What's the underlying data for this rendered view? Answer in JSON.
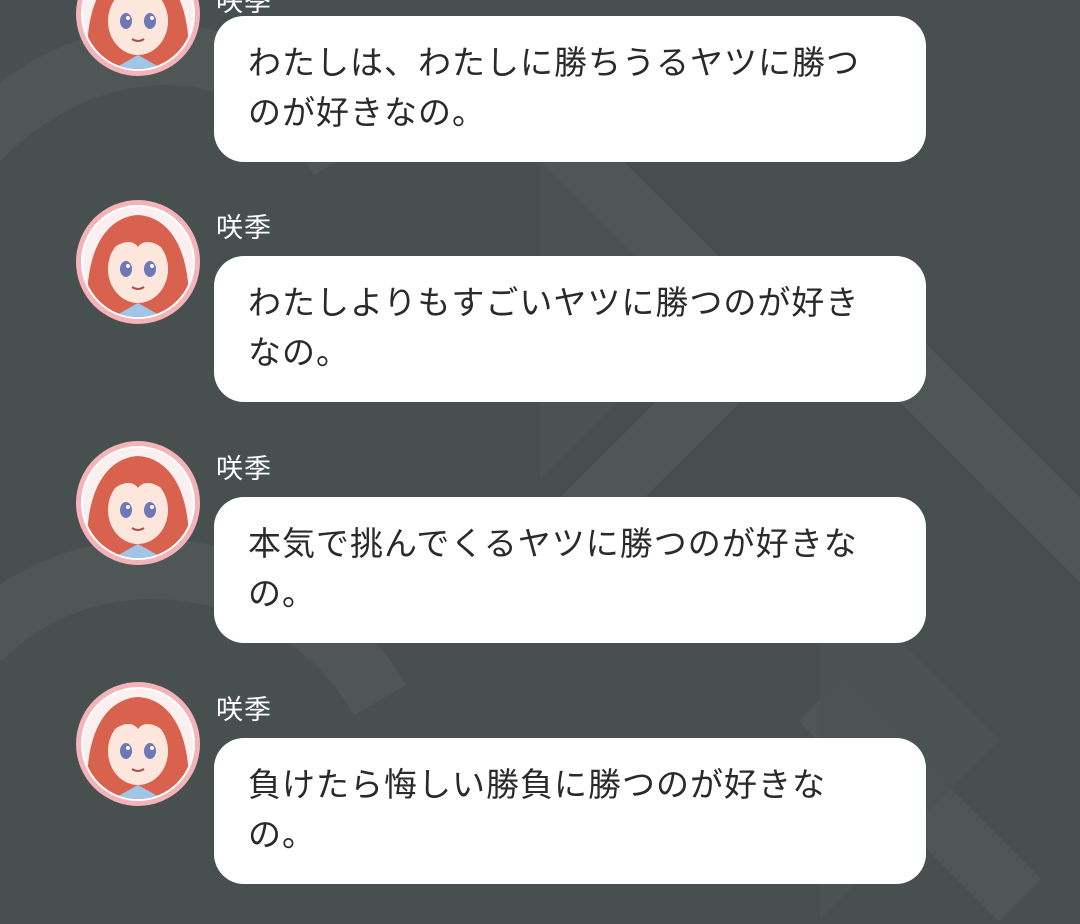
{
  "chat": {
    "messages": [
      {
        "sender": "咲季",
        "text": "わたしは、わたしに勝ちうるヤツに勝つのが好きなの。",
        "avatar_icon": "character-avatar-icon"
      },
      {
        "sender": "咲季",
        "text": "わたしよりもすごいヤツに勝つのが好きなの。",
        "avatar_icon": "character-avatar-icon"
      },
      {
        "sender": "咲季",
        "text": "本気で挑んでくるヤツに勝つのが好きなの。",
        "avatar_icon": "character-avatar-icon"
      },
      {
        "sender": "咲季",
        "text": "負けたら悔しい勝負に勝つのが好きなの。",
        "avatar_icon": "character-avatar-icon"
      }
    ]
  },
  "colors": {
    "background": "#48504f",
    "bubble": "#ffffff",
    "avatar_ring": "#f3b3b8",
    "hair": "#d9624f"
  }
}
